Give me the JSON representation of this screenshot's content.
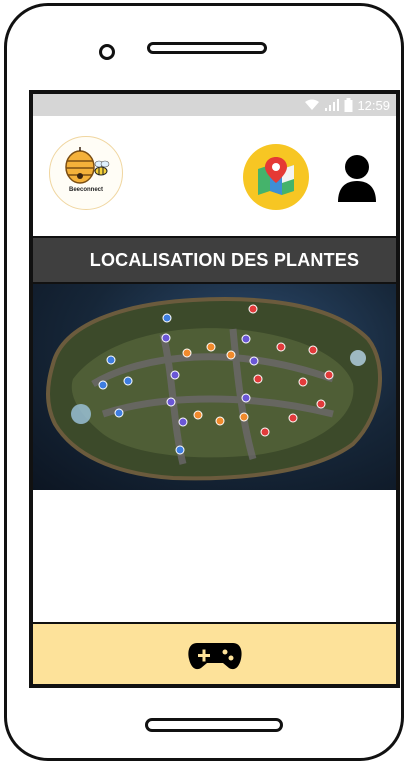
{
  "status_bar": {
    "time": "12:59",
    "icons": [
      "wifi-icon",
      "signal-icon",
      "battery-icon"
    ]
  },
  "header": {
    "logo_text": "Beeconnect",
    "logo_icon": "beehive-icon",
    "map_button_icon": "map-pin-icon",
    "profile_button_icon": "user-icon"
  },
  "page": {
    "title": "LOCALISATION DES PLANTES"
  },
  "footer": {
    "game_button_icon": "gamepad-icon"
  },
  "colors": {
    "title_bar": "#3f3f3f",
    "footer_bar": "#fde29a",
    "map_button": "#f7c623",
    "status_bar": "#d6d6d6"
  }
}
